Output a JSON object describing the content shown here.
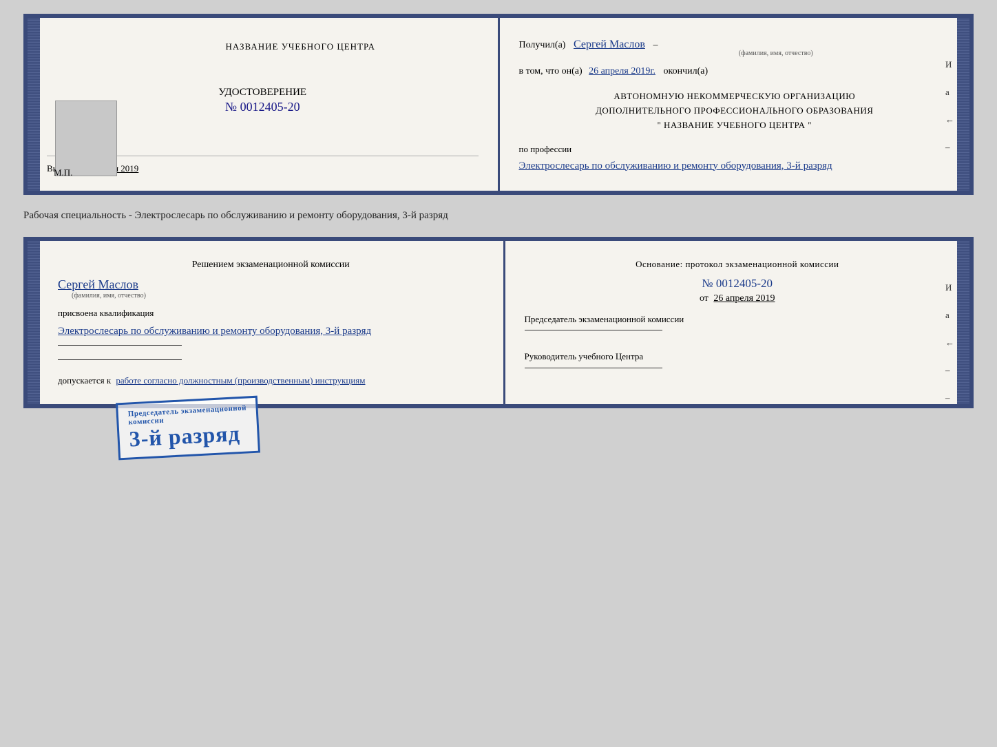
{
  "top_document": {
    "left": {
      "institution_label": "НАЗВАНИЕ УЧЕБНОГО ЦЕНТРА",
      "certificate_label": "УДОСТОВЕРЕНИЕ",
      "certificate_number": "№ 0012405-20",
      "issued_prefix": "Выдано",
      "issued_date": "26 апреля 2019",
      "mp_label": "М.П."
    },
    "right": {
      "received_prefix": "Получил(а)",
      "recipient_name": "Сергей Маслов",
      "fio_hint": "(фамилия, имя, отчество)",
      "dash": "–",
      "in_that_prefix": "в том, что он(а)",
      "completion_date": "26 апреля 2019г.",
      "completion_suffix": "окончил(а)",
      "org_line1": "АВТОНОМНУЮ НЕКОММЕРЧЕСКУЮ ОРГАНИЗАЦИЮ",
      "org_line2": "ДОПОЛНИТЕЛЬНОГО ПРОФЕССИОНАЛЬНОГО ОБРАЗОВАНИЯ",
      "org_line3": "\"   НАЗВАНИЕ УЧЕБНОГО ЦЕНТРА   \"",
      "profession_prefix": "по профессии",
      "profession_text": "Электрослесарь по обслуживанию и ремонту оборудования, 3-й разряд",
      "right_marks": [
        "И",
        "а",
        "←",
        "–"
      ]
    }
  },
  "between_label": {
    "text": "Рабочая специальность - Электрослесарь по обслуживанию и ремонту оборудования, 3-й разряд"
  },
  "bottom_document": {
    "left": {
      "decision_label": "Решением экзаменационной комиссии",
      "person_name": "Сергей Маслов",
      "fio_hint": "(фамилия, имя, отчество)",
      "qualification_prefix": "присвоена квалификация",
      "qualification_text": "Электрослесарь по обслуживанию и ремонту оборудования, 3-й разряд",
      "allowed_prefix": "допускается к",
      "allowed_text": "работе согласно должностным (производственным) инструкциям"
    },
    "right": {
      "basis_prefix": "Основание: протокол экзаменационной комиссии",
      "basis_number": "№  0012405-20",
      "basis_date_prefix": "от",
      "basis_date": "26 апреля 2019",
      "chairman_label": "Председатель экзаменационной комиссии",
      "leader_label": "Руководитель учебного Центра",
      "right_marks": [
        "И",
        "а",
        "←",
        "–",
        "–"
      ]
    },
    "stamp": {
      "line1": "Председатель экзаменационной",
      "line2": "комиссии",
      "main_text": "3-й разряд"
    }
  }
}
